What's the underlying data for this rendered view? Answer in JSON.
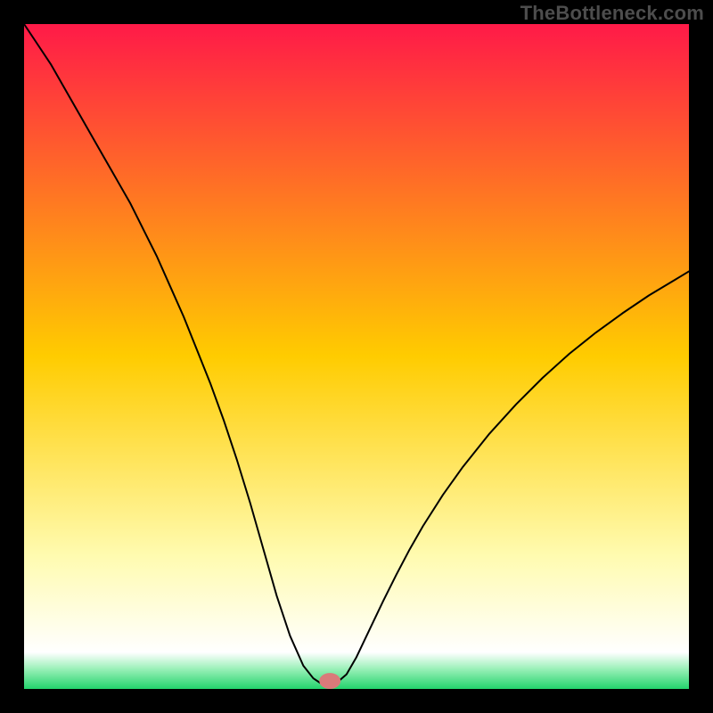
{
  "watermark": "TheBottleneck.com",
  "chart_data": {
    "type": "line",
    "title": "",
    "xlabel": "",
    "ylabel": "",
    "xlim": [
      0,
      100
    ],
    "ylim": [
      0,
      100
    ],
    "grid": false,
    "legend": false,
    "background_gradient_stops": [
      {
        "offset": 0.0,
        "color": "#ff1a48"
      },
      {
        "offset": 0.5,
        "color": "#ffcc00"
      },
      {
        "offset": 0.8,
        "color": "#fffbb0"
      },
      {
        "offset": 0.945,
        "color": "#ffffff"
      },
      {
        "offset": 0.97,
        "color": "#9af0b8"
      },
      {
        "offset": 1.0,
        "color": "#23d36c"
      }
    ],
    "minimum_x": 45,
    "marker": {
      "x": 46,
      "y": 1.2,
      "rx": 1.6,
      "ry": 1.2,
      "color": "#d97a7a"
    },
    "series": [
      {
        "name": "bottleneck-curve",
        "color": "#000000",
        "width": 2,
        "x": [
          0,
          2,
          4,
          6,
          8,
          10,
          12,
          14,
          16,
          18,
          20,
          22,
          24,
          26,
          28,
          30,
          32,
          34,
          36,
          38,
          40,
          42,
          43.5,
          45,
          46,
          47,
          48.5,
          50,
          52,
          54,
          56,
          58,
          60,
          63,
          66,
          70,
          74,
          78,
          82,
          86,
          90,
          94,
          98,
          100
        ],
        "y": [
          100,
          97,
          94,
          90.5,
          87,
          83.5,
          80,
          76.5,
          73,
          69,
          65,
          60.5,
          56,
          51,
          46,
          40.5,
          34.5,
          28,
          21,
          14,
          8,
          3.5,
          1.6,
          0.6,
          0.6,
          0.9,
          2.2,
          4.8,
          9,
          13.2,
          17.2,
          21,
          24.5,
          29.2,
          33.4,
          38.4,
          42.8,
          46.8,
          50.4,
          53.6,
          56.5,
          59.2,
          61.6,
          62.8
        ]
      }
    ]
  }
}
